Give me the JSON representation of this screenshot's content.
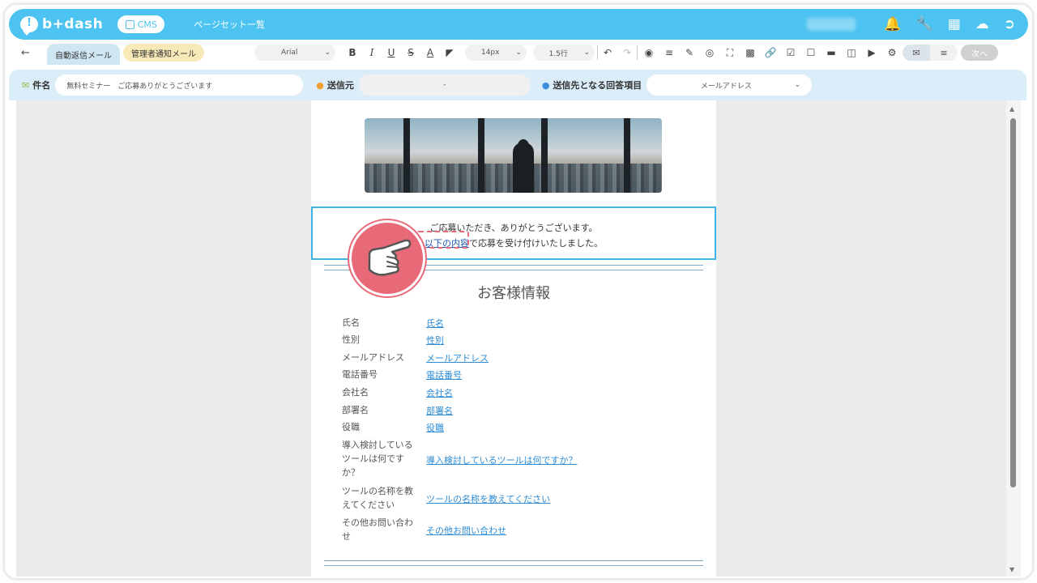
{
  "app": {
    "logo_text": "b+dash",
    "cms_label": "CMS",
    "page_title": "ページセット一覧"
  },
  "tabs": [
    {
      "label": "自動返信メール"
    },
    {
      "label": "管理者通知メール"
    }
  ],
  "toolbar": {
    "font_value": "Arial",
    "size_value": "14px",
    "line_value": "1.5行",
    "next_label": "次へ"
  },
  "meta": {
    "subject_label": "件名",
    "subject_value": "無料セミナー　ご応募ありがとうございます",
    "sender_label": "送信元",
    "sender_value": "-",
    "recipient_label": "送信先となる回答項目",
    "recipient_value": "メールアドレス"
  },
  "content": {
    "thanks_line": "ご応募いただき、ありがとうございます。",
    "link_text": "以下の内容",
    "after_link": "で応募を受け付けいたしました。",
    "section_title": "お客様情報",
    "rows": [
      {
        "label": "氏名",
        "value": "氏名"
      },
      {
        "label": "性別",
        "value": "性別"
      },
      {
        "label": "メールアドレス",
        "value": "メールアドレス"
      },
      {
        "label": "電話番号",
        "value": "電話番号"
      },
      {
        "label": "会社名",
        "value": "会社名"
      },
      {
        "label": "部署名",
        "value": "部署名"
      },
      {
        "label": "役職",
        "value": "役職"
      },
      {
        "label": "導入検討しているツールは何ですか？",
        "value": "導入検討しているツールは何ですか？"
      },
      {
        "label": "ツールの名称を教えてください",
        "value": "ツールの名称を教えてください"
      },
      {
        "label": "その他お問い合わせ",
        "value": "その他お問い合わせ"
      }
    ]
  },
  "colors": {
    "accent": "#4cc3f0",
    "selection": "#3ab6ea",
    "pointer": "#e86a78",
    "link": "#2e8cd6"
  },
  "icons": [
    "bell-icon",
    "wrench-icon",
    "grid-icon",
    "support-icon",
    "logout-icon"
  ]
}
